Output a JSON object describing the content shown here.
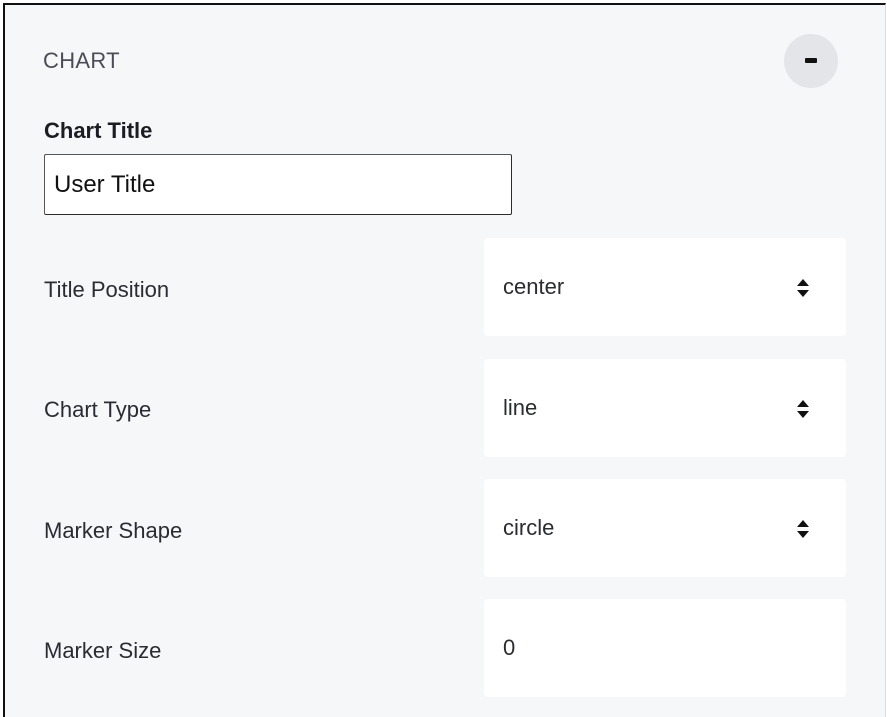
{
  "section": {
    "title": "CHART",
    "collapse_icon": "minus-icon"
  },
  "chart_title": {
    "label": "Chart Title",
    "value": "User Title"
  },
  "title_position": {
    "label": "Title Position",
    "value": "center"
  },
  "chart_type": {
    "label": "Chart Type",
    "value": "line"
  },
  "marker_shape": {
    "label": "Marker Shape",
    "value": "circle"
  },
  "marker_size": {
    "label": "Marker Size",
    "value": "0"
  }
}
